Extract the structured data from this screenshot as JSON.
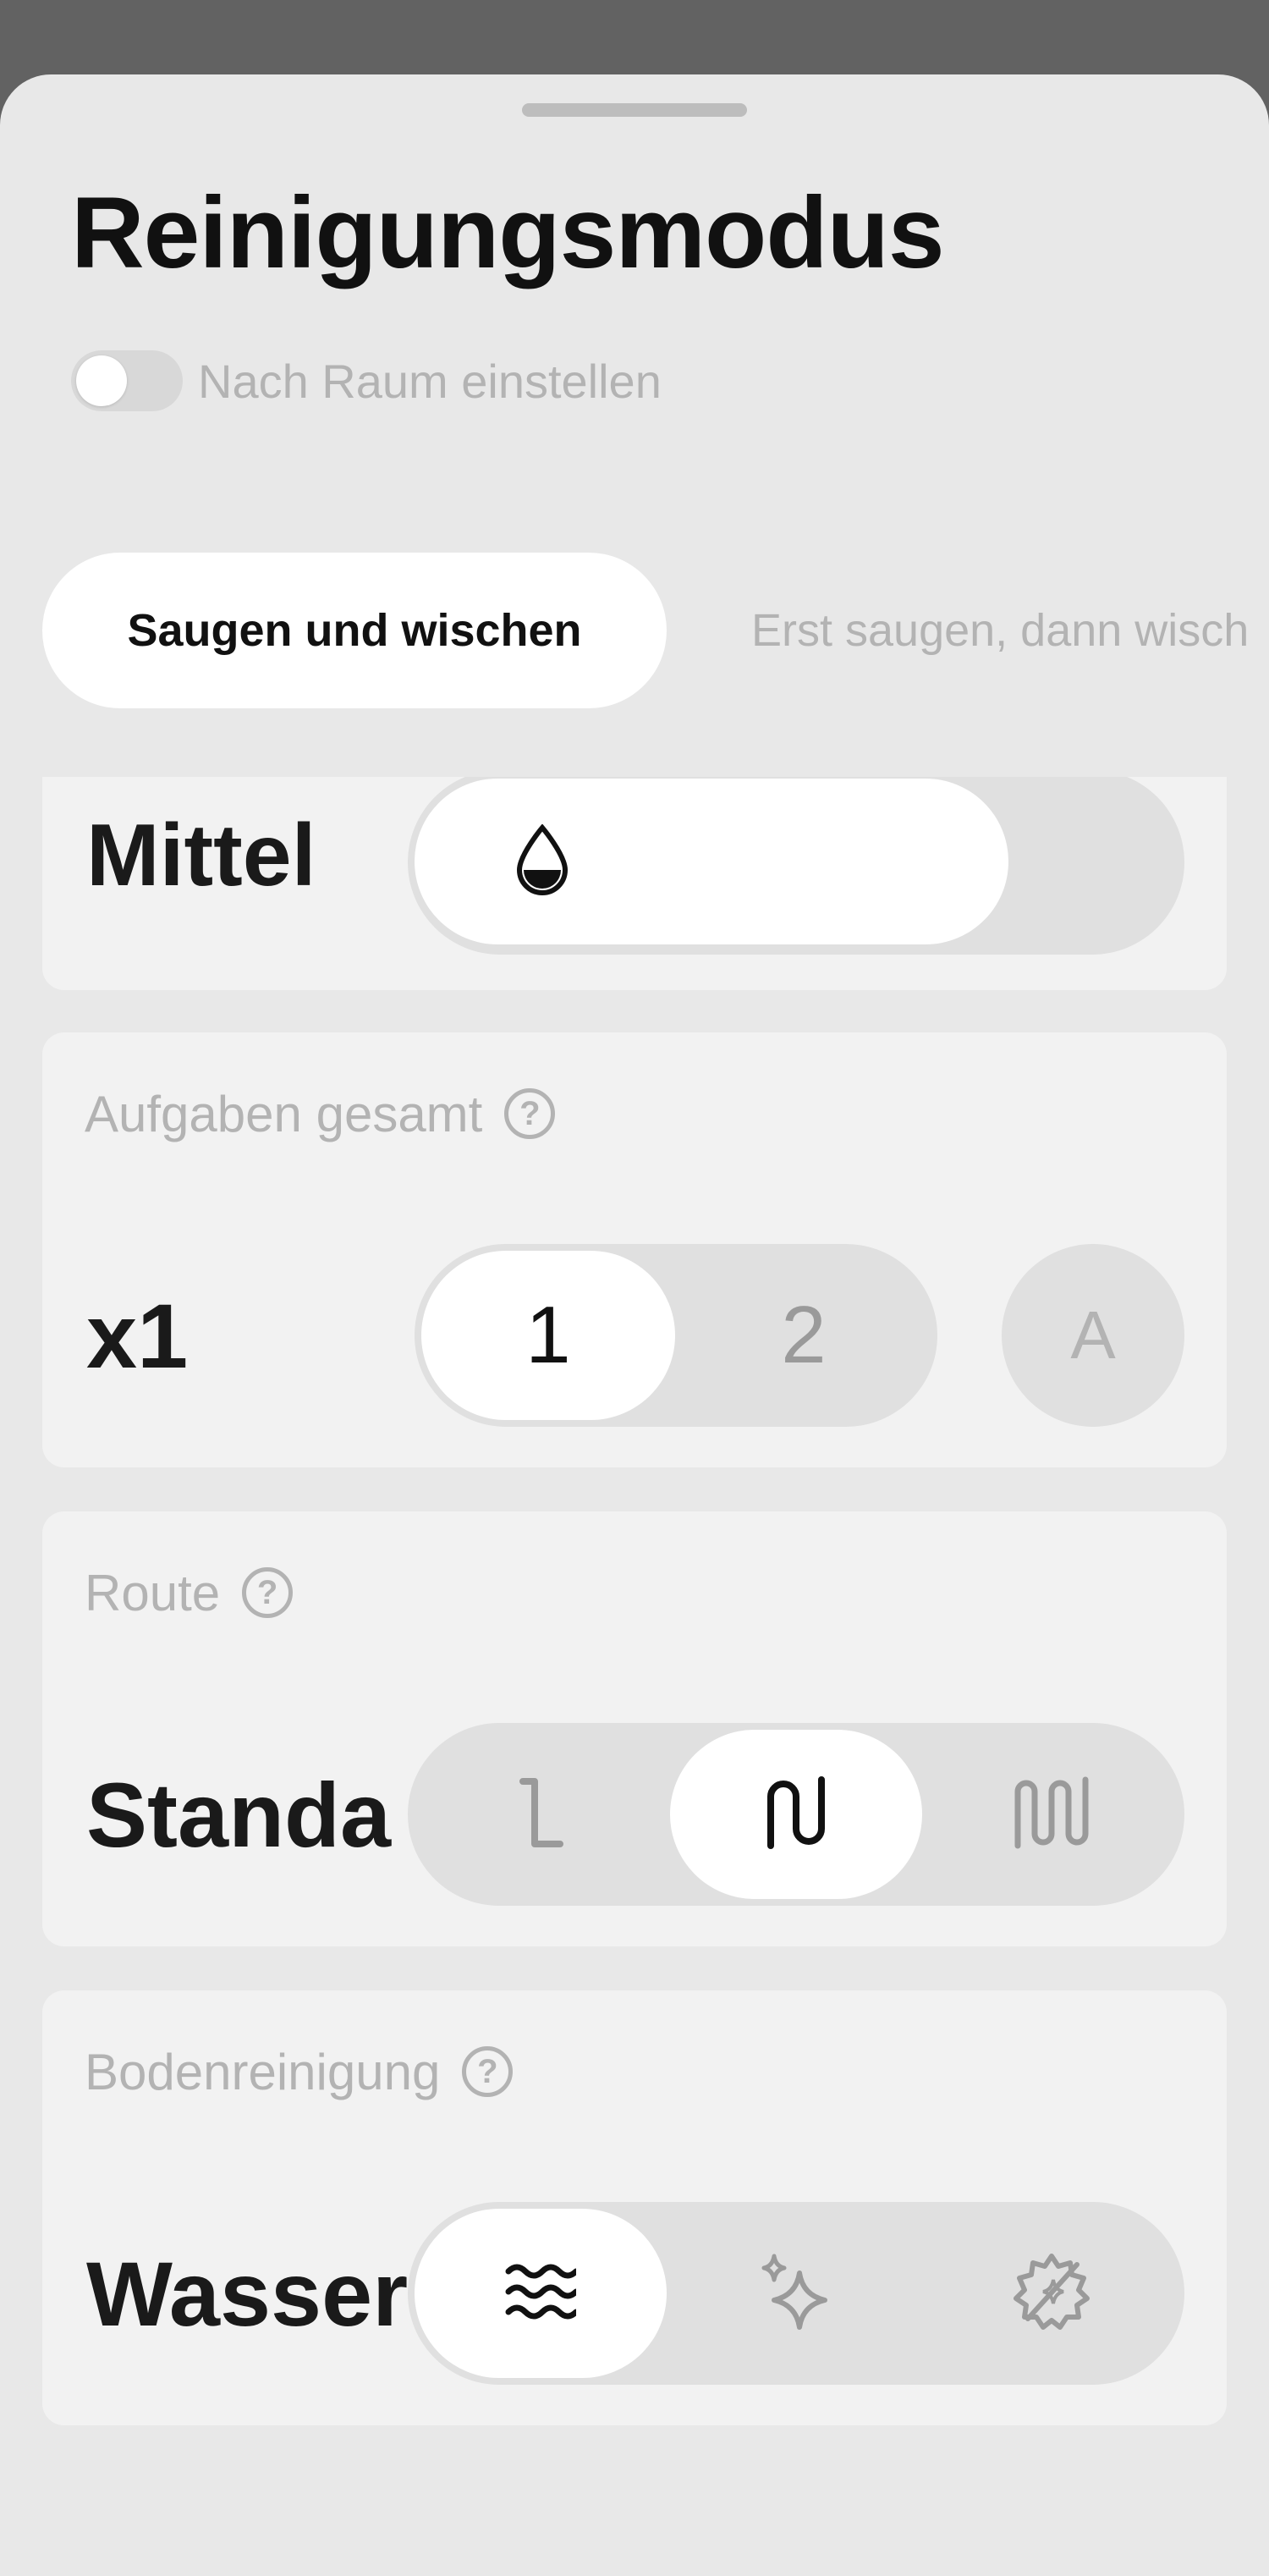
{
  "header": {
    "title": "Reinigungsmodus",
    "toggle": {
      "label": "Nach Raum einstellen",
      "on": false
    }
  },
  "tabs": [
    {
      "label": "Saugen und wischen",
      "active": true
    },
    {
      "label": "Erst saugen, dann wisch",
      "active": false
    }
  ],
  "water_card": {
    "value": "Mittel",
    "level": 0.7,
    "icon": "water-drop-half-icon"
  },
  "passes_card": {
    "label": "Aufgaben gesamt",
    "value": "x1",
    "options": [
      "1",
      "2"
    ],
    "selected": "1",
    "auto_label": "A"
  },
  "route_card": {
    "label": "Route",
    "value": "Standa",
    "options": [
      "route-quick-icon",
      "route-standard-icon",
      "route-deep-icon"
    ],
    "selected_index": 1
  },
  "floor_card": {
    "label": "Bodenreinigung",
    "value": "Wasser",
    "options": [
      "water-waves-icon",
      "sparkle-icon",
      "no-sparkle-icon"
    ],
    "selected_index": 0
  },
  "colors": {
    "backdrop": "#626262",
    "sheet": "#e8e8e8",
    "card": "#f2f2f2",
    "segment": "#e0e0e0",
    "active": "#ffffff",
    "muted_text": "#b3b3b3"
  }
}
